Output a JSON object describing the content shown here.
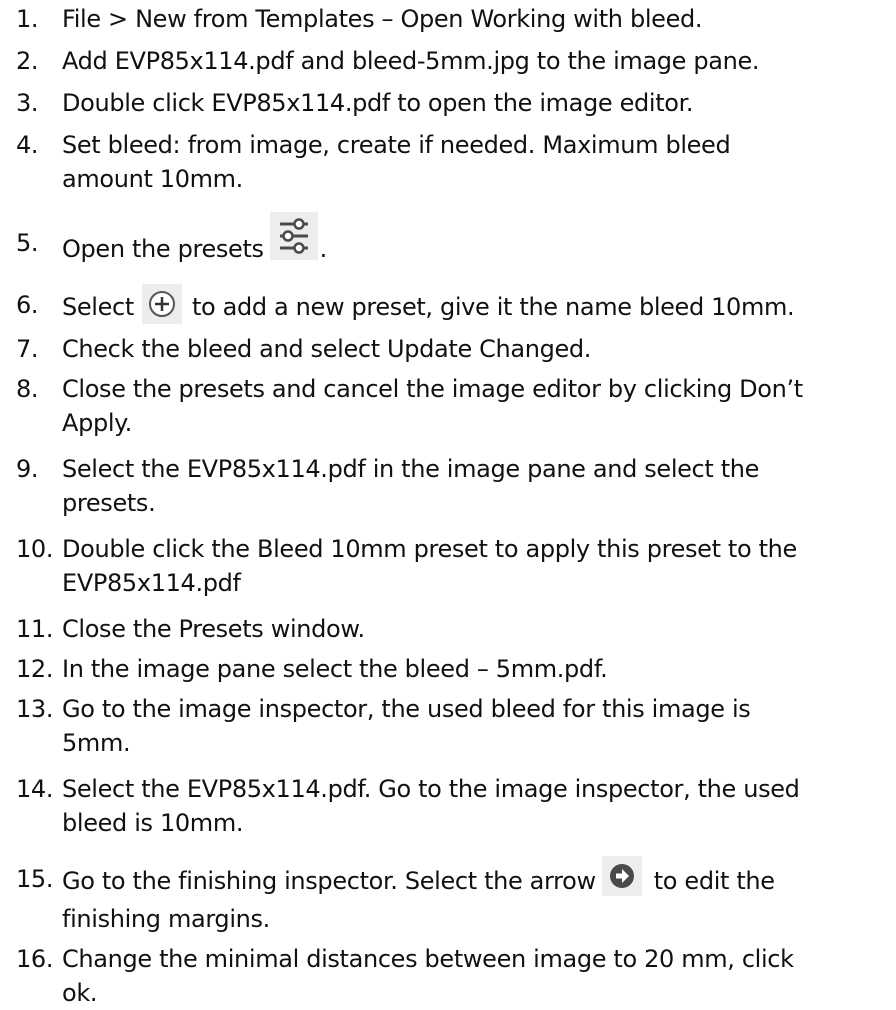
{
  "steps": [
    {
      "number": "1.",
      "text": "File > New from Templates – Open Working with bleed."
    },
    {
      "number": "2.",
      "text": "Add EVP85x114.pdf and bleed-5mm.jpg to the image pane."
    },
    {
      "number": "3.",
      "text": "Double click EVP85x114.pdf to open the image editor."
    },
    {
      "number": "4.",
      "text": "Set bleed: from image, create if needed. Maximum bleed",
      "text2": "amount 10mm."
    },
    {
      "number": "5.",
      "before": "Open the presets",
      "icon": "presets-sliders-icon",
      "after": "."
    },
    {
      "number": "6.",
      "before": "Select",
      "icon": "add-circle-icon",
      "after": "to add a new preset, give it the name bleed 10mm."
    },
    {
      "number": "7.",
      "text": "Check the bleed and select Update Changed."
    },
    {
      "number": "8.",
      "text": "Close the presets and cancel the image editor by clicking Don’t",
      "text2": "Apply."
    },
    {
      "number": "9.",
      "text": "Select the EVP85x114.pdf in the image pane and select the",
      "text2": "presets."
    },
    {
      "number": "10.",
      "text": "Double click the Bleed 10mm preset to apply this preset to the",
      "text2": "EVP85x114.pdf"
    },
    {
      "number": "11.",
      "text": "Close the Presets window."
    },
    {
      "number": "12.",
      "text": "In the image pane select the bleed – 5mm.pdf."
    },
    {
      "number": "13.",
      "text": "Go to the image inspector, the used bleed for this image is",
      "text2": "5mm."
    },
    {
      "number": "14.",
      "text": "Select the EVP85x114.pdf. Go to the image inspector, the used",
      "text2": "bleed is 10mm."
    },
    {
      "number": "15.",
      "before": "Go to the finishing inspector. Select the arrow",
      "icon": "arrow-circle-icon",
      "after": "to edit the",
      "text2": "finishing margins."
    },
    {
      "number": "16.",
      "text": "Change the minimal distances between image to 20 mm, click",
      "text2": "ok."
    }
  ]
}
